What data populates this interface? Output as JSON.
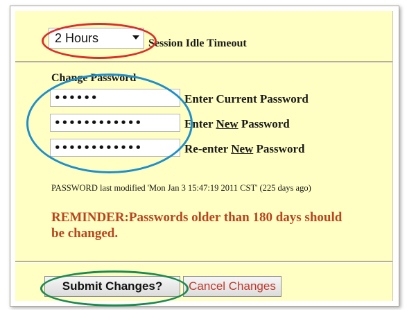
{
  "session": {
    "timeout_value": "2 Hours",
    "timeout_label": "Session Idle Timeout"
  },
  "password": {
    "heading": "Change Password",
    "current_mask": "••••••",
    "new_mask": "••••••••••••",
    "reenter_mask": "••••••••••••",
    "current_label": "Enter Current Password",
    "new_label_prefix": "Enter ",
    "new_word": "New",
    "new_label_suffix": " Password",
    "reenter_label_prefix": "Re-enter ",
    "reenter_label_suffix": " Password"
  },
  "info": {
    "last_modified": "PASSWORD last modified 'Mon Jan 3 15:47:19 2011 CST' (225 days ago)",
    "reminder": "REMINDER:Passwords older than 180 days should be changed."
  },
  "buttons": {
    "submit": "Submit Changes?",
    "cancel": "Cancel Changes"
  },
  "colors": {
    "panel_bg": "#ffffc4",
    "reminder_text": "#b8451e",
    "cancel_text": "#c0392b",
    "highlight_red": "#d9302a",
    "highlight_blue": "#1f8fc9",
    "highlight_green": "#1b8a4f"
  }
}
